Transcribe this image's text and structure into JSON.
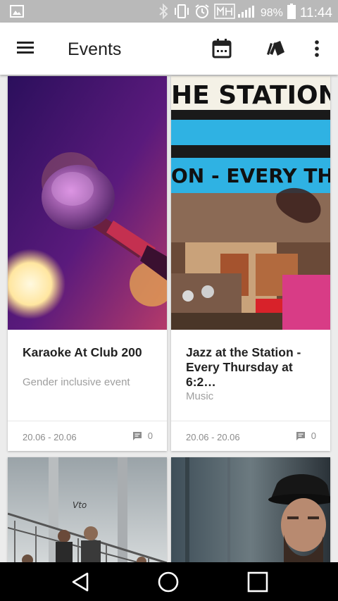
{
  "status_bar": {
    "battery": "98%",
    "time": "11:44",
    "icons": [
      "image-notification-icon",
      "bluetooth-icon",
      "vibrate-icon",
      "alarm-icon",
      "signal-icon",
      "battery-icon"
    ]
  },
  "appbar": {
    "title": "Events",
    "icons": [
      "menu-icon",
      "calendar-icon",
      "tags-icon",
      "more-vert-icon"
    ]
  },
  "events": [
    {
      "title": "Karaoke At Club 200",
      "subtitle": "Gender inclusive event",
      "dates": "20.06 - 20.06",
      "comments": "0"
    },
    {
      "title": "Jazz at the Station - Every Thursday at 6:2…",
      "subtitle": "Music",
      "dates": "20.06 - 20.06",
      "comments": "0",
      "poster_line1": "HE STATION",
      "poster_line2": "ON - EVERY THU"
    },
    {
      "title": "",
      "subtitle": "",
      "dates": "",
      "comments": ""
    },
    {
      "title": "",
      "subtitle": "",
      "dates": "",
      "comments": ""
    }
  ],
  "navbar": {
    "icons": [
      "back-icon",
      "home-icon",
      "recents-icon"
    ]
  },
  "colors": {
    "status_bar": "#b9b9b9",
    "app_bar": "#ffffff",
    "nav_bar": "#000000",
    "poster_blue": "#2fb2e3"
  }
}
